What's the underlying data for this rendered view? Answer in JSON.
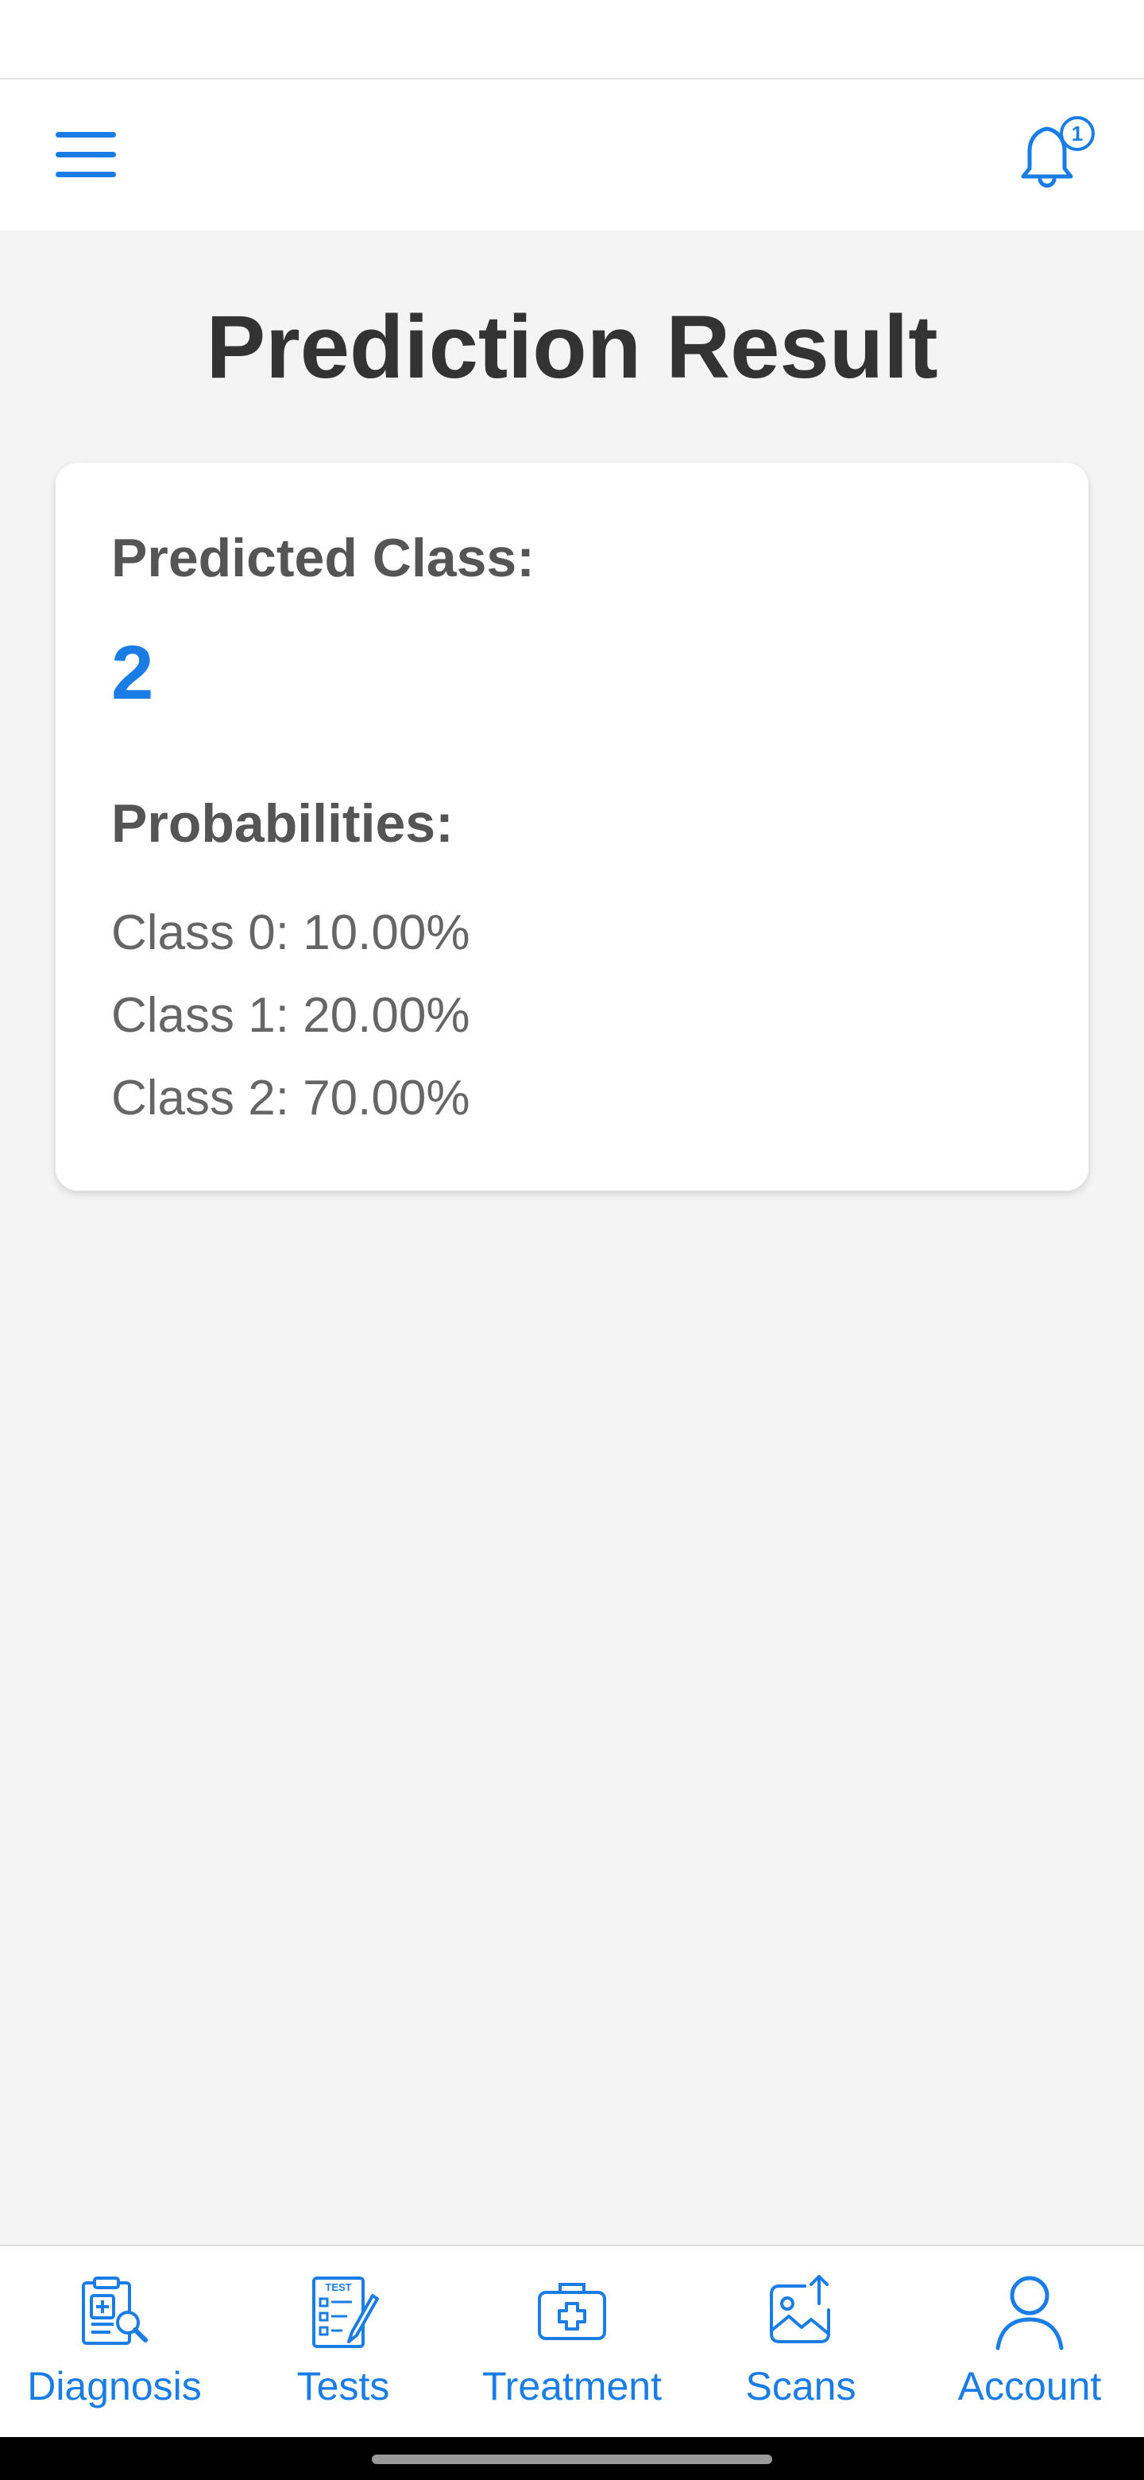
{
  "header": {
    "menu_icon": "hamburger-menu-icon",
    "notification_icon": "bell-icon",
    "notification_count": "1"
  },
  "page": {
    "title": "Prediction Result"
  },
  "result": {
    "predicted_label": "Predicted Class:",
    "predicted_value": "2",
    "probabilities_label": "Probabilities:",
    "probabilities": [
      "Class 0: 10.00%",
      "Class 1: 20.00%",
      "Class 2: 70.00%"
    ]
  },
  "bottom_nav": {
    "items": [
      {
        "label": "Diagnosis",
        "icon": "clipboard-search-icon"
      },
      {
        "label": "Tests",
        "icon": "test-checklist-icon"
      },
      {
        "label": "Treatment",
        "icon": "medical-kit-icon"
      },
      {
        "label": "Scans",
        "icon": "image-upload-icon"
      },
      {
        "label": "Account",
        "icon": "user-icon"
      }
    ]
  },
  "colors": {
    "accent": "#1a7de6",
    "title_text": "#333333",
    "label_text": "#555555",
    "body_text": "#666666",
    "background": "#f4f4f4",
    "surface": "#ffffff"
  }
}
